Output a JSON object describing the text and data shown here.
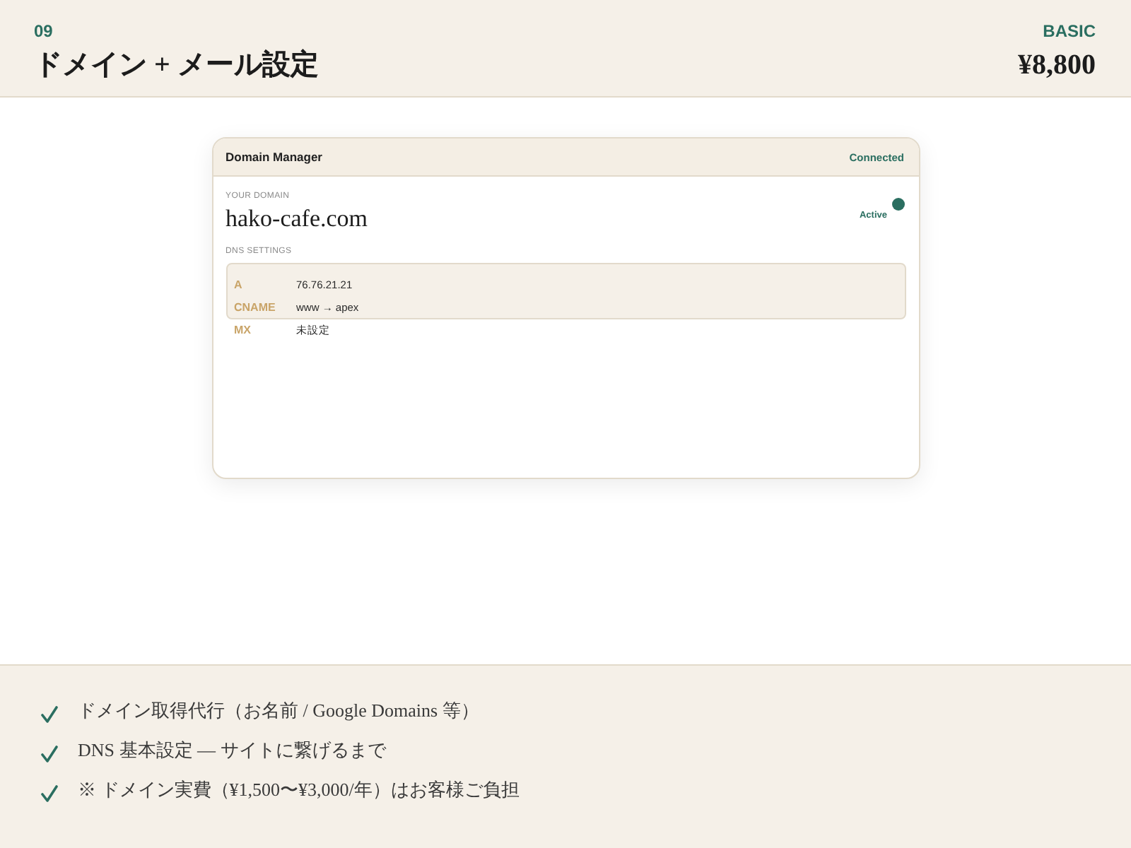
{
  "slide": {
    "number": "09",
    "title": "ドメイン + メール設定",
    "tier": "BASIC",
    "price": "¥8,800"
  },
  "window": {
    "title": "Domain Manager",
    "status": "Connected",
    "domain_label": "YOUR DOMAIN",
    "domain": "hako-cafe.com",
    "domain_status": "Active",
    "dns_label": "DNS SETTINGS",
    "dns_records": [
      {
        "type": "A",
        "value": "76.76.21.21"
      },
      {
        "type": "CNAME",
        "value": "www → apex"
      },
      {
        "type": "MX",
        "value": "未設定"
      }
    ]
  },
  "features": [
    "ドメイン取得代行（お名前 / Google Domains 等）",
    "DNS 基本設定 — サイトに繋げるまで",
    "※ ドメイン実費（¥1,500〜¥3,000/年）はお客様ご負担"
  ]
}
